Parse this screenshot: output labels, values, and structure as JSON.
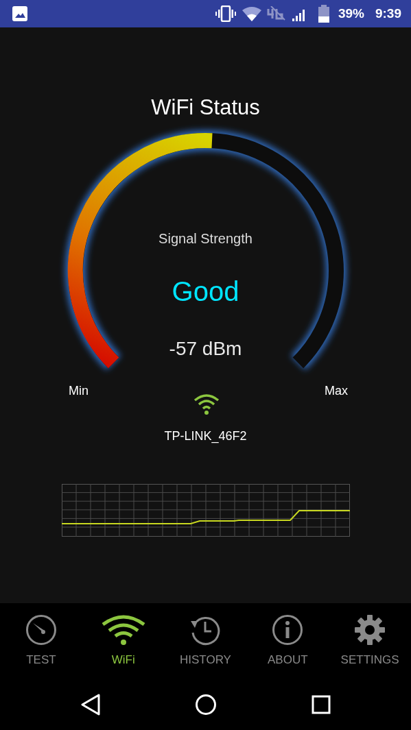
{
  "status_bar": {
    "battery": "39%",
    "time": "9:39"
  },
  "title": "WiFi Status",
  "gauge": {
    "label": "Signal Strength",
    "quality": "Good",
    "reading": "-57 dBm",
    "min_label": "Min",
    "max_label": "Max"
  },
  "network": {
    "ssid": "TP-LINK_46F2"
  },
  "tabs": [
    {
      "label": "TEST",
      "selected": false
    },
    {
      "label": "WiFi",
      "selected": true
    },
    {
      "label": "HISTORY",
      "selected": false
    },
    {
      "label": "ABOUT",
      "selected": false
    },
    {
      "label": "SETTINGS",
      "selected": false
    }
  ]
}
